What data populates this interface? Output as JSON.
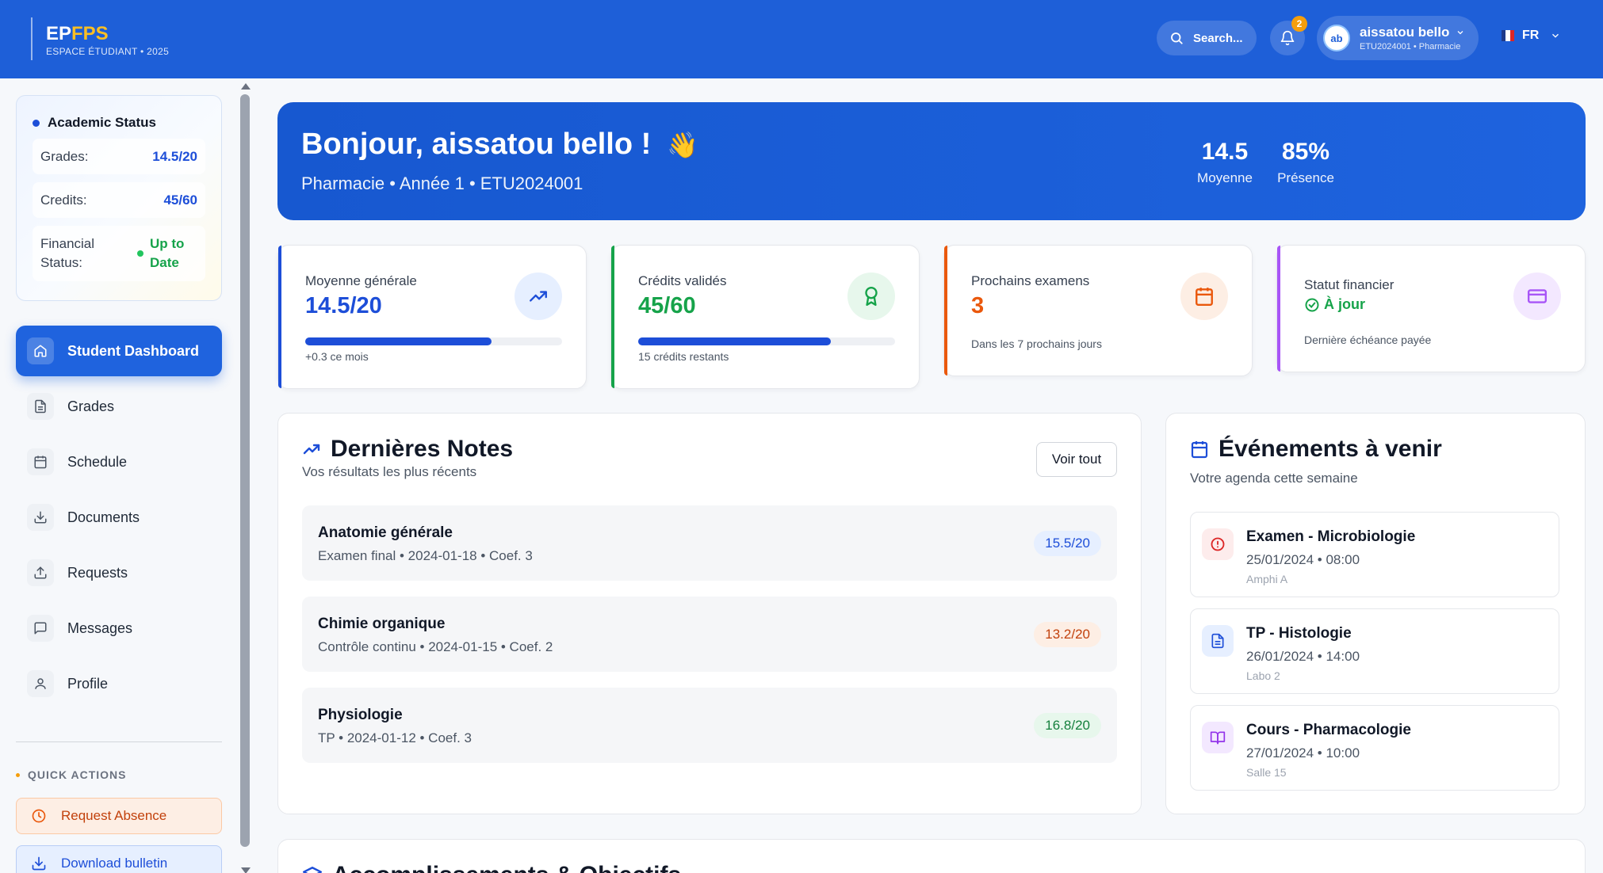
{
  "header": {
    "logo_main": "EP",
    "logo_accent": "FPS",
    "logo_sub": "ESPACE ÉTUDIANT • 2025",
    "search_label": "Search...",
    "notification_count": "2",
    "user": {
      "initials": "ab",
      "name": "aissatou bello",
      "sub": "ETU2024001 • Pharmacie"
    },
    "language": "FR"
  },
  "sidebar": {
    "status": {
      "title": "Academic Status",
      "grades_label": "Grades:",
      "grades_value": "14.5/20",
      "credits_label": "Credits:",
      "credits_value": "45/60",
      "financial_label": "Financial Status:",
      "financial_value": "Up to Date"
    },
    "nav": [
      {
        "label": "Student Dashboard",
        "icon": "home-icon"
      },
      {
        "label": "Grades",
        "icon": "document-icon"
      },
      {
        "label": "Schedule",
        "icon": "calendar-icon"
      },
      {
        "label": "Documents",
        "icon": "download-icon"
      },
      {
        "label": "Requests",
        "icon": "upload-icon"
      },
      {
        "label": "Messages",
        "icon": "message-icon"
      },
      {
        "label": "Profile",
        "icon": "user-icon"
      }
    ],
    "quick_actions_title": "QUICK ACTIONS",
    "quick_actions": [
      {
        "label": "Request Absence",
        "icon": "clock-icon"
      },
      {
        "label": "Download bulletin",
        "icon": "download-icon"
      }
    ]
  },
  "hero": {
    "greeting": "Bonjour, aissatou bello !",
    "emoji": "👋",
    "subtitle": "Pharmacie • Année 1 • ETU2024001",
    "stats": [
      {
        "value": "14.5",
        "label": "Moyenne"
      },
      {
        "value": "85%",
        "label": "Présence"
      }
    ]
  },
  "cards": [
    {
      "label": "Moyenne générale",
      "value": "14.5/20",
      "note": "+0.3 ce mois",
      "progress": 0.725,
      "color": "#1d4ed8",
      "icon": "trending-up-icon"
    },
    {
      "label": "Crédits validés",
      "value": "45/60",
      "note": "15 crédits restants",
      "progress": 0.75,
      "color": "#16a34a",
      "icon": "award-icon"
    },
    {
      "label": "Prochains examens",
      "value": "3",
      "note": "Dans les 7 prochains jours",
      "color": "#ea580c",
      "icon": "calendar-icon"
    },
    {
      "label": "Statut financier",
      "value": "À jour",
      "note": "Dernière échéance payée",
      "color": "#a855f7",
      "icon": "credit-card-icon"
    }
  ],
  "grades_panel": {
    "title": "Dernières Notes",
    "subtitle": "Vos résultats les plus récents",
    "button": "Voir tout",
    "items": [
      {
        "name": "Anatomie générale",
        "meta": "Examen final  •  2024-01-18  •  Coef. 3",
        "score": "15.5/20",
        "color": "#1d4ed8",
        "bg": "#e6efff"
      },
      {
        "name": "Chimie organique",
        "meta": "Contrôle continu  •  2024-01-15  •  Coef. 2",
        "score": "13.2/20",
        "color": "#c2410c",
        "bg": "#fdeee4"
      },
      {
        "name": "Physiologie",
        "meta": "TP  •  2024-01-12  •  Coef. 3",
        "score": "16.8/20",
        "color": "#15803d",
        "bg": "#e7f7ec"
      }
    ]
  },
  "events_panel": {
    "title": "Événements à venir",
    "subtitle": "Votre agenda cette semaine",
    "items": [
      {
        "name": "Examen - Microbiologie",
        "date": "25/01/2024 • 08:00",
        "location": "Amphi A",
        "icon": "alert-icon",
        "color": "#dc2626",
        "bg": "#fdecec"
      },
      {
        "name": "TP - Histologie",
        "date": "26/01/2024 • 14:00",
        "location": "Labo 2",
        "icon": "document-icon",
        "color": "#1d4ed8",
        "bg": "#e6efff"
      },
      {
        "name": "Cours - Pharmacologie",
        "date": "27/01/2024 • 10:00",
        "location": "Salle 15",
        "icon": "book-icon",
        "color": "#9333ea",
        "bg": "#f3e8ff"
      }
    ]
  },
  "achievements_panel": {
    "title": "Accomplissements & Objectifs"
  }
}
